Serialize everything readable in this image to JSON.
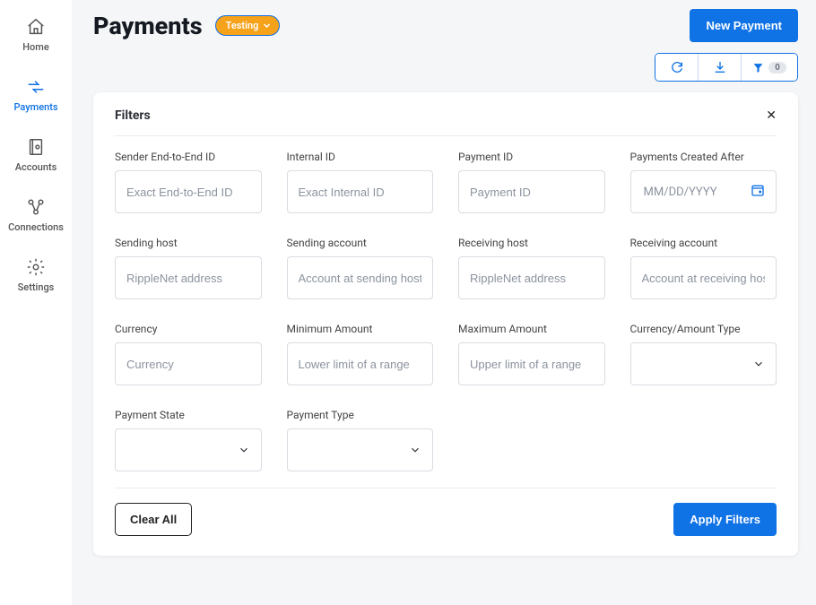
{
  "sidebar": {
    "items": [
      {
        "label": "Home"
      },
      {
        "label": "Payments"
      },
      {
        "label": "Accounts"
      },
      {
        "label": "Connections"
      },
      {
        "label": "Settings"
      }
    ]
  },
  "header": {
    "title": "Payments",
    "env_badge": "Testing",
    "new_button": "New Payment"
  },
  "toolbar": {
    "filter_count": "0"
  },
  "filters_panel": {
    "title": "Filters",
    "fields": {
      "sender_e2e": {
        "label": "Sender End-to-End ID",
        "placeholder": "Exact End-to-End ID"
      },
      "internal_id": {
        "label": "Internal ID",
        "placeholder": "Exact Internal ID"
      },
      "payment_id": {
        "label": "Payment ID",
        "placeholder": "Payment ID"
      },
      "created_after": {
        "label": "Payments Created After",
        "placeholder": "MM/DD/YYYY"
      },
      "sending_host": {
        "label": "Sending host",
        "placeholder": "RippleNet address"
      },
      "sending_account": {
        "label": "Sending account",
        "placeholder": "Account at sending host"
      },
      "receiving_host": {
        "label": "Receiving host",
        "placeholder": "RippleNet address"
      },
      "receiving_account": {
        "label": "Receiving account",
        "placeholder": "Account at receiving host"
      },
      "currency": {
        "label": "Currency",
        "placeholder": "Currency"
      },
      "min_amount": {
        "label": "Minimum Amount",
        "placeholder": "Lower limit of a range"
      },
      "max_amount": {
        "label": "Maximum Amount",
        "placeholder": "Upper limit of a range"
      },
      "currency_amount_type": {
        "label": "Currency/Amount Type"
      },
      "payment_state": {
        "label": "Payment State"
      },
      "payment_type": {
        "label": "Payment Type"
      }
    },
    "clear_all": "Clear All",
    "apply": "Apply Filters"
  }
}
